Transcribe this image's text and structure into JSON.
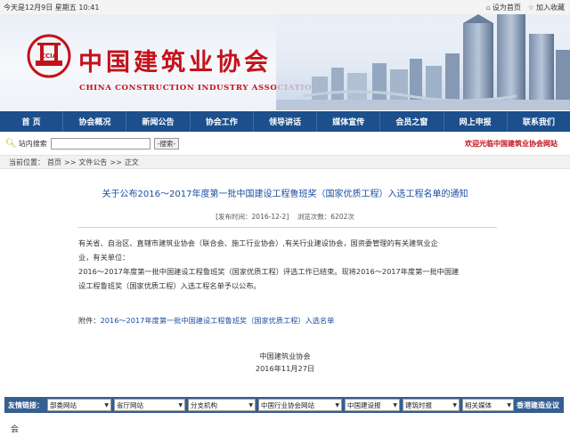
{
  "topbar": {
    "date": "今天是12月9日 星期五 10:41",
    "set_home": "设为首页",
    "bookmark": "加入收藏"
  },
  "header": {
    "logo_text": "CCIA",
    "title_cn": "中国建筑业协会",
    "title_en": "CHINA CONSTRUCTION INDUSTRY ASSOCIATION"
  },
  "nav": {
    "items": [
      "首 页",
      "协会概况",
      "新闻公告",
      "协会工作",
      "领导讲话",
      "媒体宣传",
      "会员之窗",
      "网上申报",
      "联系我们"
    ]
  },
  "search": {
    "label": "站内搜索",
    "button": "-搜索-",
    "value": ""
  },
  "welcome": "欢迎光临中国建筑业协会网站",
  "breadcrumb": {
    "current_label": "当前位置：",
    "home": "首页",
    "sep": ">>",
    "section": "文件公告",
    "page": "正文"
  },
  "article": {
    "title": "关于公布2016～2017年度第一批中国建设工程鲁班奖（国家优质工程）入选工程名单的通知",
    "meta_publish": "[发布时间：2016-12-2]",
    "meta_views": "浏览次数：6202次",
    "para1_line1": "有关省、自治区、直辖市建筑业协会（联合会、施工行业协会）,有关行业建设协会，国资委管理的有关建筑业企",
    "para1_line2": "业，有关单位：",
    "para2_line1": "2016～2017年度第一批中国建设工程鲁班奖（国家优质工程）评选工作已结束。现将2016～2017年度第一批中国建",
    "para2_line2": "设工程鲁班奖（国家优质工程）入选工程名单予以公布。",
    "attachment_label": "附件：",
    "attachment_link": "2016～2017年度第一批中国建设工程鲁班奖（国家优质工程）入选名单",
    "sign_org": "中国建筑业协会",
    "sign_date": "2016年11月27日"
  },
  "friend_links": {
    "label": "友情链接：",
    "selects": [
      "部委网站",
      "省厅网站",
      "分支机构",
      "中国行业协会网站",
      "中国建设报",
      "建筑时报",
      "相关媒体"
    ],
    "last": "香港建造业议"
  },
  "footer_fragment": "会",
  "colors": {
    "brand_red": "#c4121b",
    "nav_blue": "#1c4f8c",
    "title_blue": "#1a4ea3",
    "friend_bar": "#365e91"
  }
}
